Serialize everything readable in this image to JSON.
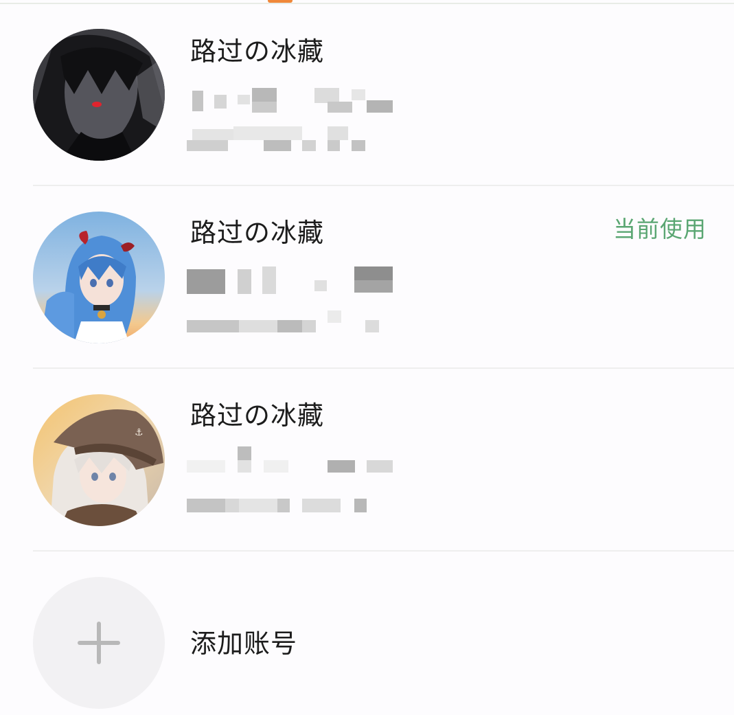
{
  "accounts": [
    {
      "name": "路过の冰藏",
      "avatar_icon": "avatar-dark-hooded-character",
      "current": false
    },
    {
      "name": "路过の冰藏",
      "avatar_icon": "avatar-blue-hair-character",
      "current": true,
      "current_label": "当前使用"
    },
    {
      "name": "路过の冰藏",
      "avatar_icon": "avatar-white-hair-cap-character",
      "current": false
    }
  ],
  "add_account": {
    "label": "添加账号",
    "icon": "plus-icon"
  },
  "colors": {
    "current_badge": "#5aa672",
    "tab_indicator": "#f0883a"
  }
}
